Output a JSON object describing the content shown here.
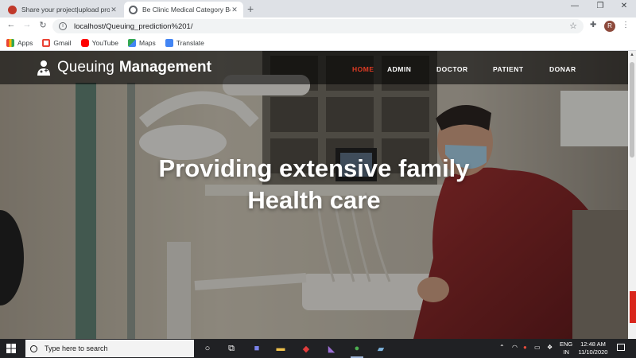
{
  "browser": {
    "tabs": [
      {
        "title": "Share your project|upload project",
        "active": false,
        "favicon_color": "#c0392b"
      },
      {
        "title": "Be Clinic Medical Category Bootstrap",
        "active": true,
        "favicon_color": "#5f6368"
      }
    ],
    "new_tab_icon": "plus-icon",
    "window_controls": [
      "minimize-icon",
      "restore-icon",
      "close-icon"
    ],
    "nav": {
      "back_icon": "back-arrow-icon",
      "forward_icon": "forward-arrow-icon",
      "reload_icon": "reload-icon"
    },
    "address": "localhost/Queuing_prediction%201/",
    "avatar_letter": "R",
    "bookmarks": [
      {
        "label": "Apps",
        "color": "#ea4335"
      },
      {
        "label": "Gmail",
        "color": "#ea4335"
      },
      {
        "label": "YouTube",
        "color": "#ff0000"
      },
      {
        "label": "Maps",
        "color": "#34a853"
      },
      {
        "label": "Translate",
        "color": "#4285f4"
      }
    ]
  },
  "site": {
    "brand_regular": "Queuing",
    "brand_bold": "Management",
    "menu": [
      {
        "label": "HOME",
        "active": true
      },
      {
        "label": "ADMIN",
        "active": false
      },
      {
        "label": "DOCTOR",
        "active": false
      },
      {
        "label": "PATIENT",
        "active": false
      },
      {
        "label": "DONAR",
        "active": false
      }
    ],
    "hero_line1": "Providing extensive family",
    "hero_line2": "Health care",
    "accent_color": "#e03b24"
  },
  "taskbar": {
    "search_placeholder": "Type here to search",
    "lang_line1": "ENG",
    "lang_line2": "IN",
    "time": "12:48 AM",
    "date": "11/10/2020"
  }
}
